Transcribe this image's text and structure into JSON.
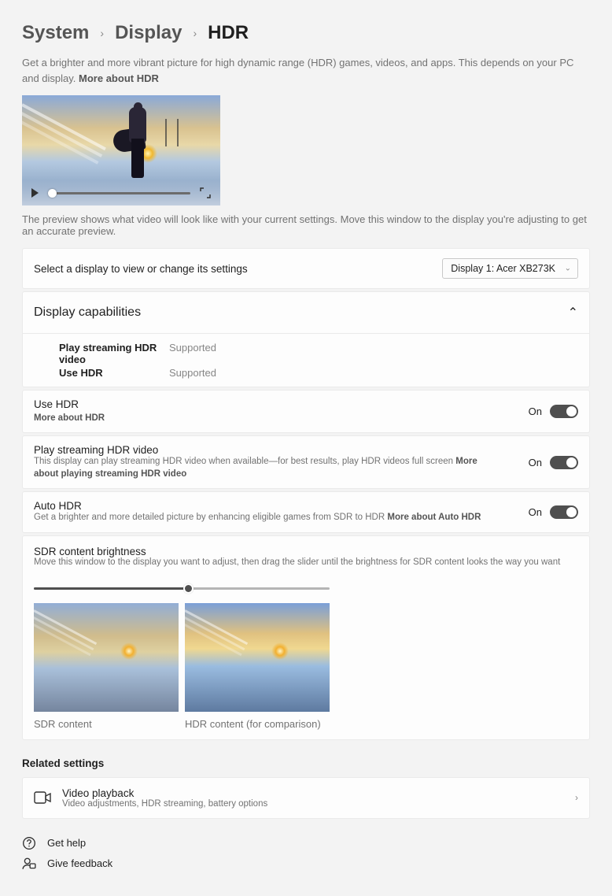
{
  "breadcrumb": {
    "item0": "System",
    "item1": "Display",
    "current": "HDR"
  },
  "desc": {
    "text": "Get a brighter and more vibrant picture for high dynamic range (HDR) games, videos, and apps. This depends on your PC and display. ",
    "link": "More about HDR"
  },
  "preview_note": "The preview shows what video will look like with your current settings. Move this window to the display you're adjusting to get an accurate preview.",
  "select_display": {
    "label": "Select a display to view or change its settings",
    "selected": "Display 1: Acer XB273K"
  },
  "capabilities": {
    "header": "Display capabilities",
    "row0_k": "Play streaming HDR video",
    "row0_v": "Supported",
    "row1_k": "Use HDR",
    "row1_v": "Supported"
  },
  "use_hdr": {
    "title": "Use HDR",
    "link": "More about HDR",
    "state": "On"
  },
  "stream_hdr": {
    "title": "Play streaming HDR video",
    "sub": "This display can play streaming HDR video when available—for best results, play HDR videos full screen  ",
    "link": "More about playing streaming HDR video",
    "state": "On"
  },
  "auto_hdr": {
    "title": "Auto HDR",
    "sub": "Get a brighter and more detailed picture by enhancing eligible games from SDR to HDR  ",
    "link": "More about Auto HDR",
    "state": "On"
  },
  "sdr": {
    "title": "SDR content brightness",
    "sub": "Move this window to the display you want to adjust, then drag the slider until the brightness for SDR content looks the way you want",
    "label_sdr": "SDR content",
    "label_hdr": "HDR content (for comparison)"
  },
  "related": {
    "section": "Related settings",
    "video_title": "Video playback",
    "video_sub": "Video adjustments, HDR streaming, battery options"
  },
  "footer": {
    "help": "Get help",
    "feedback": "Give feedback"
  }
}
